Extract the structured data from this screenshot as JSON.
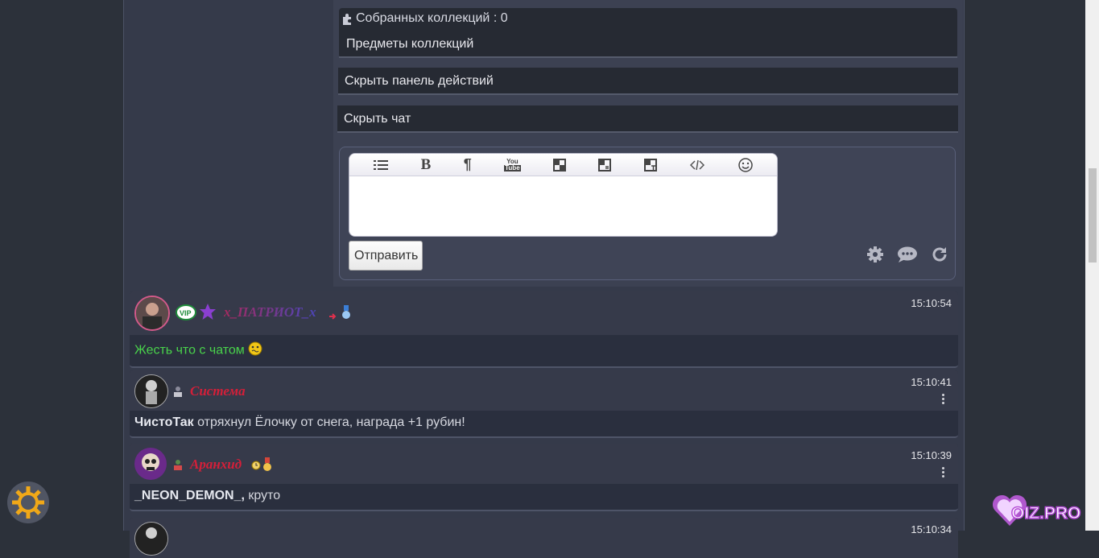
{
  "collections": {
    "count_label": "Собранных коллекций : 0",
    "items_label": "Предметы коллекций"
  },
  "bars": {
    "hide_actions": "Скрыть панель действий",
    "hide_chat": "Скрыть чат"
  },
  "composer": {
    "toolbar_icons": [
      "list-icon",
      "bold-icon",
      "paragraph-icon",
      "youtube-icon",
      "quote-icon",
      "spoiler-icon",
      "translit-icon",
      "code-icon",
      "smiley-icon"
    ],
    "toolbar_labels": {
      "bold": "B",
      "paragraph": "¶",
      "youtube_top": "You",
      "youtube_bottom": "Tube"
    },
    "message_value": "",
    "send_label": "Отправить",
    "right_tools": [
      "settings-icon",
      "chat-bubble-icon",
      "refresh-icon"
    ]
  },
  "messages": [
    {
      "nick": "x_ПАТРИОТ_x",
      "time": "15:10:54",
      "text": "Жесть что с чатом",
      "badges": [
        "vip-badge-icon",
        "purple-star-icon",
        "arrow-icon",
        "medal-icon"
      ],
      "nick_color": "#6e3fb8",
      "text_color": "#49d34b"
    },
    {
      "nick": "Система",
      "time": "15:10:41",
      "bold_part": "ЧистоТак",
      "text": " отряхнул Ёлочку от снега, награда +1 рубин!",
      "badges": [
        "user-role-icon"
      ],
      "nick_color": "#d41f39"
    },
    {
      "nick": "Аранхид",
      "time": "15:10:39",
      "bold_part": "_NEON_DEMON_,",
      "text": " круто",
      "badges": [
        "moderator-icon",
        "clock-icon",
        "medal-icon"
      ],
      "nick_color": "#d41f39"
    },
    {
      "time": "15:10:34"
    }
  ],
  "logo": {
    "text": "OIZ.PRO",
    "accent": "#c85fe8"
  },
  "colors": {
    "page": "#2c313a",
    "panel": "#262a33",
    "accent_red": "#d41f39"
  }
}
